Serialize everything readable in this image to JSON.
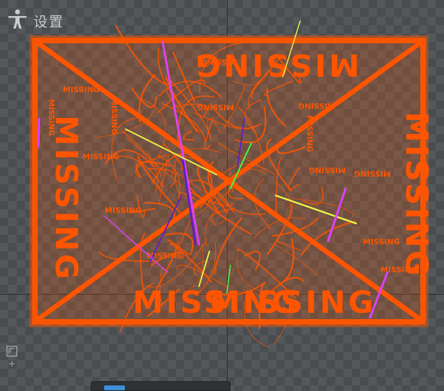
{
  "header": {
    "title": "设置",
    "icon": "person-pose-icon"
  },
  "placeholder": {
    "label_main": "MISSING",
    "label_small": "MISSING",
    "colors": {
      "orange": "#ff5500",
      "magenta": "#e040ff",
      "yellow": "#e8f24a",
      "green": "#40ff40",
      "purple": "#6020c0"
    }
  },
  "toolbar": {
    "ruler_icon": "ruler-icon",
    "zoom_symbol": "+"
  }
}
